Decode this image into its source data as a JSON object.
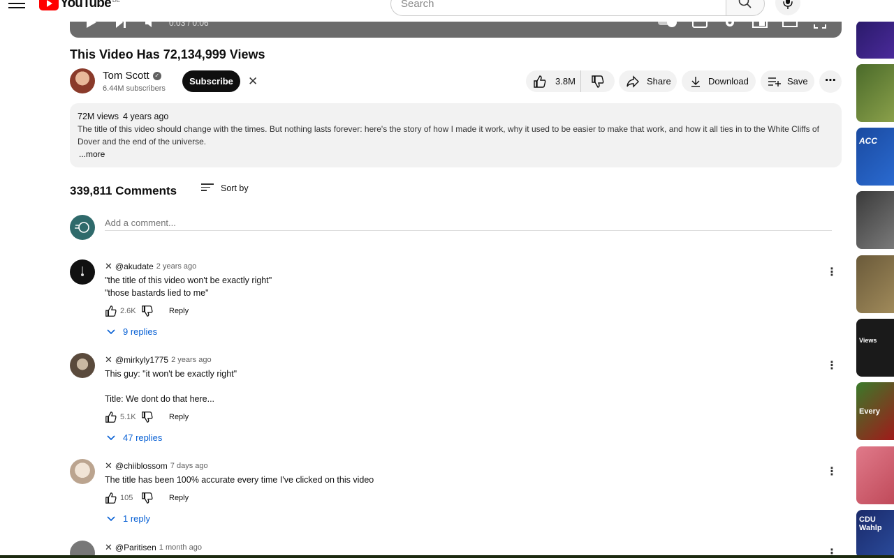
{
  "header": {
    "logo_text": "YouTube",
    "logo_country": "DE",
    "search_placeholder": "Search"
  },
  "player": {
    "time": "0:03 / 0:06"
  },
  "video": {
    "title": "This Video Has 72,134,999 Views",
    "channel": "Tom Scott",
    "subscribers": "6.44M subscribers",
    "subscribe_label": "Subscribe",
    "likes": "3.8M",
    "share_label": "Share",
    "download_label": "Download",
    "save_label": "Save"
  },
  "description": {
    "views": "72M views",
    "age": "4 years ago",
    "text": "The title of this video should change with the times. But nothing lasts forever: here's the story of how I made it work, why it used to be easier to make that work, and how it all ties in to the White Cliffs of Dover and the end of the universe.",
    "more": "...more"
  },
  "comments_header": {
    "count": "339,811 Comments",
    "sort_label": "Sort by",
    "add_placeholder": "Add a comment..."
  },
  "comments": [
    {
      "author": "@akudate",
      "time": "2 years ago",
      "text": "\"the title of this video won't be exactly right\"\n\"those bastards lied to me\"",
      "likes": "2.6K",
      "reply_label": "Reply",
      "replies": "9 replies"
    },
    {
      "author": "@mirkyly1775",
      "time": "2 years ago",
      "text": "This guy: \"it won't be exactly right\"\n\nTitle: We dont do that here...",
      "likes": "5.1K",
      "reply_label": "Reply",
      "replies": "47 replies"
    },
    {
      "author": "@chiiblossom",
      "time": "7 days ago",
      "text": "The title has been 100% accurate every time I've clicked on this video",
      "likes": "105",
      "reply_label": "Reply",
      "replies": "1 reply"
    },
    {
      "author": "@Paritisen",
      "time": "1 month ago"
    }
  ],
  "sidebar": {
    "captions": [
      "Views",
      "Every",
      "CDU Wahlp",
      "ACC"
    ]
  },
  "colors": {
    "accent_red": "#ff0000",
    "link_blue": "#065fd4",
    "pill_bg": "#f2f2f2"
  }
}
